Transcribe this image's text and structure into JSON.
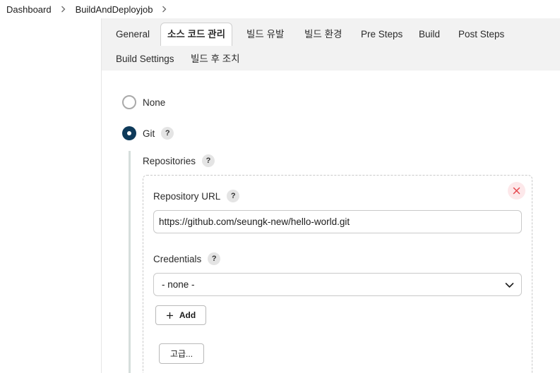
{
  "breadcrumb": {
    "items": [
      "Dashboard",
      "BuildAndDeployjob"
    ],
    "separator_icon": "chevron-right-icon"
  },
  "tabs": [
    {
      "label": "General",
      "active": false
    },
    {
      "label": "소스 코드 관리",
      "active": true
    },
    {
      "label": "빌드 유발",
      "active": false
    },
    {
      "label": "빌드 환경",
      "active": false
    },
    {
      "label": "Pre Steps",
      "active": false
    },
    {
      "label": "Build",
      "active": false
    },
    {
      "label": "Post Steps",
      "active": false
    },
    {
      "label": "Build Settings",
      "active": false
    },
    {
      "label": "빌드 후 조치",
      "active": false
    }
  ],
  "scm": {
    "options": [
      {
        "label": "None",
        "selected": false
      },
      {
        "label": "Git",
        "selected": true
      }
    ],
    "help_glyph": "?",
    "repositories_label": "Repositories",
    "repository_url_label": "Repository URL",
    "repository_url_value": "https://github.com/seungk-new/hello-world.git",
    "credentials_label": "Credentials",
    "credentials_selected": "- none -",
    "add_button_label": "Add",
    "advanced_button_label": "고급...",
    "delete_icon": "close-icon"
  },
  "colors": {
    "radio_selected": "#0e3a5a",
    "delete_icon": "#e5484d",
    "delete_bg": "#fde8ea",
    "tabbar_bg": "#f2f2f2"
  }
}
